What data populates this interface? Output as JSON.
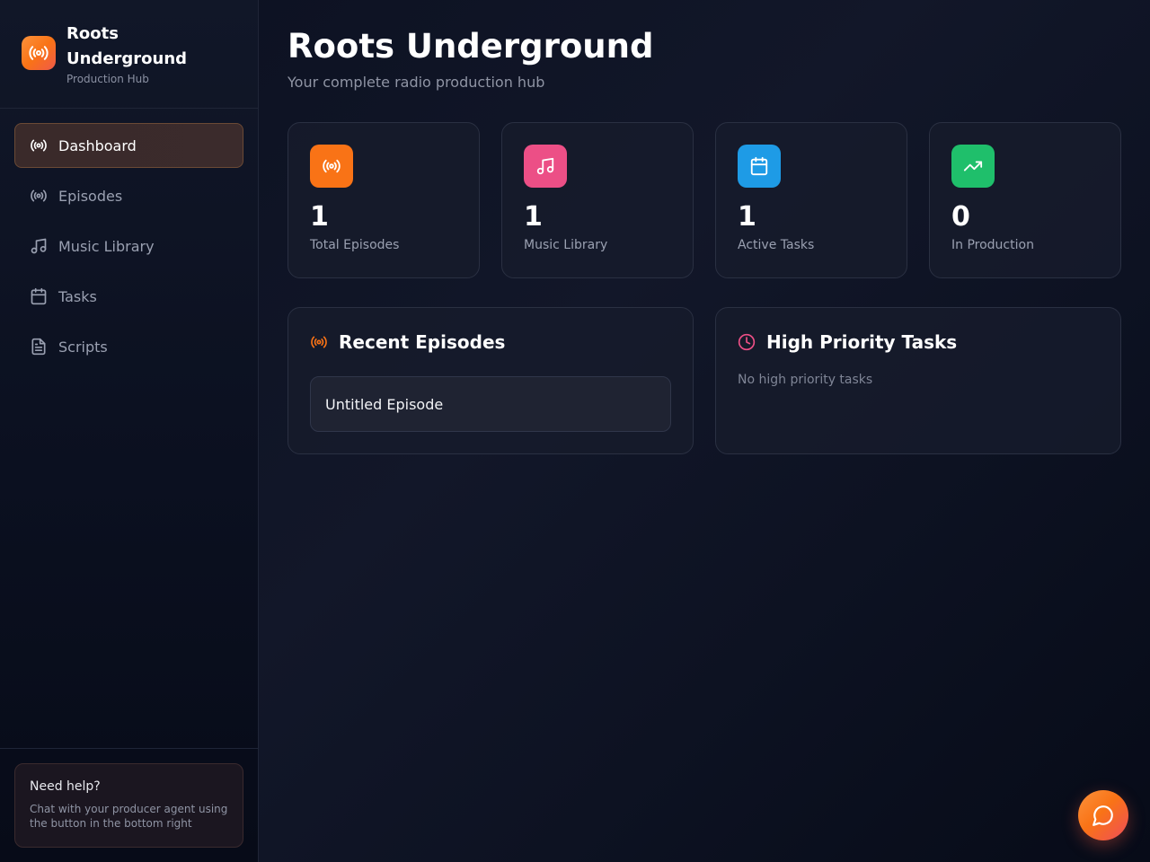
{
  "app": {
    "title": "Roots Underground",
    "subtitle": "Production Hub",
    "logo_icon": "radio-icon",
    "accent": "#f97316"
  },
  "sidebar": {
    "items": [
      {
        "label": "Dashboard",
        "icon": "radio-icon",
        "active": true
      },
      {
        "label": "Episodes",
        "icon": "radio-icon",
        "active": false
      },
      {
        "label": "Music Library",
        "icon": "music-icon",
        "active": false
      },
      {
        "label": "Tasks",
        "icon": "calendar-icon",
        "active": false
      },
      {
        "label": "Scripts",
        "icon": "document-icon",
        "active": false
      }
    ],
    "help": {
      "title": "Need help?",
      "text": "Chat with your producer agent using the button in the bottom right"
    }
  },
  "header": {
    "title": "Roots Underground",
    "subtitle": "Your complete radio production hub"
  },
  "stats": [
    {
      "value": "1",
      "label": "Total Episodes",
      "icon": "radio-icon",
      "color": "#f97316"
    },
    {
      "value": "1",
      "label": "Music Library",
      "icon": "music-icon",
      "color": "#ec4899"
    },
    {
      "value": "1",
      "label": "Active Tasks",
      "icon": "calendar-icon",
      "color": "#0ea5e9"
    },
    {
      "value": "0",
      "label": "In Production",
      "icon": "trending-up-icon",
      "color": "#22c55e"
    }
  ],
  "recent_episodes": {
    "title": "Recent Episodes",
    "icon": "radio-icon",
    "items": [
      {
        "title": "Untitled Episode"
      }
    ]
  },
  "high_priority_tasks": {
    "title": "High Priority Tasks",
    "icon": "clock-icon",
    "empty_text": "No high priority tasks"
  },
  "chat_button": {
    "icon": "chat-bubble-icon"
  }
}
